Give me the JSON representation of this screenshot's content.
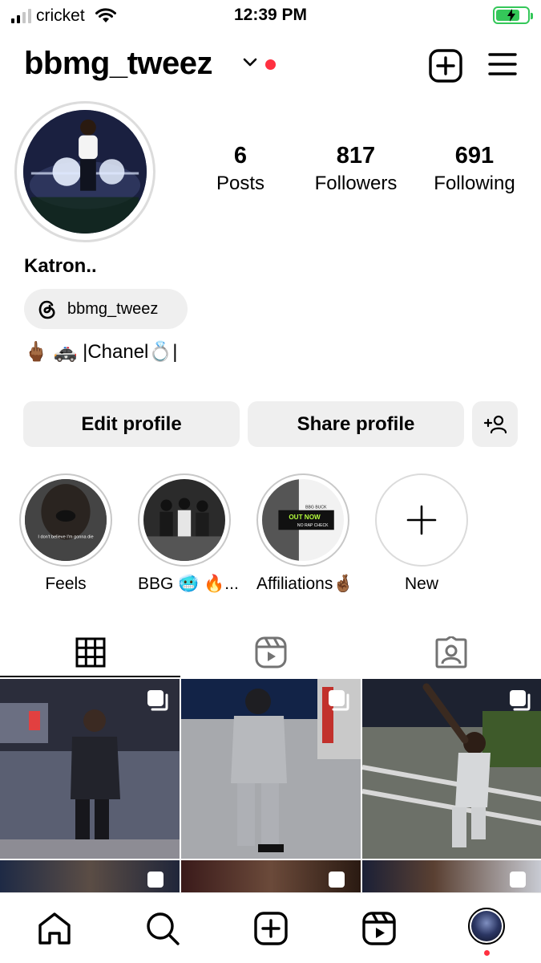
{
  "status_bar": {
    "carrier": "cricket",
    "time": "12:39 PM",
    "battery_level": 0.75
  },
  "header": {
    "username": "bbmg_tweez",
    "icons": [
      "chevron-down-icon",
      "notification-dot",
      "create-icon",
      "menu-icon"
    ]
  },
  "profile": {
    "stats": [
      {
        "value": "6",
        "label": "Posts"
      },
      {
        "value": "817",
        "label": "Followers"
      },
      {
        "value": "691",
        "label": "Following"
      }
    ],
    "display_name": "Katron..",
    "threads_handle": "bbmg_tweez",
    "bio": "🖕🏾 🚓 |Chanel💍|"
  },
  "actions": {
    "edit_label": "Edit profile",
    "share_label": "Share profile"
  },
  "highlights": [
    {
      "label": "Feels",
      "caption": "I don't believe I'm gonna die"
    },
    {
      "label": "BBG 🥶 🔥..."
    },
    {
      "label": "Affiliations🤞🏾",
      "caption": "OUT NOW",
      "sub": "BBG BUCK",
      "sub2": "NO RAP CHECK"
    },
    {
      "label": "New"
    }
  ],
  "tabs": [
    "grid-icon",
    "reels-icon",
    "tagged-icon"
  ],
  "colors": {
    "accent_red": "#ff3040",
    "button_bg": "#efefef",
    "battery_green": "#34c759"
  }
}
